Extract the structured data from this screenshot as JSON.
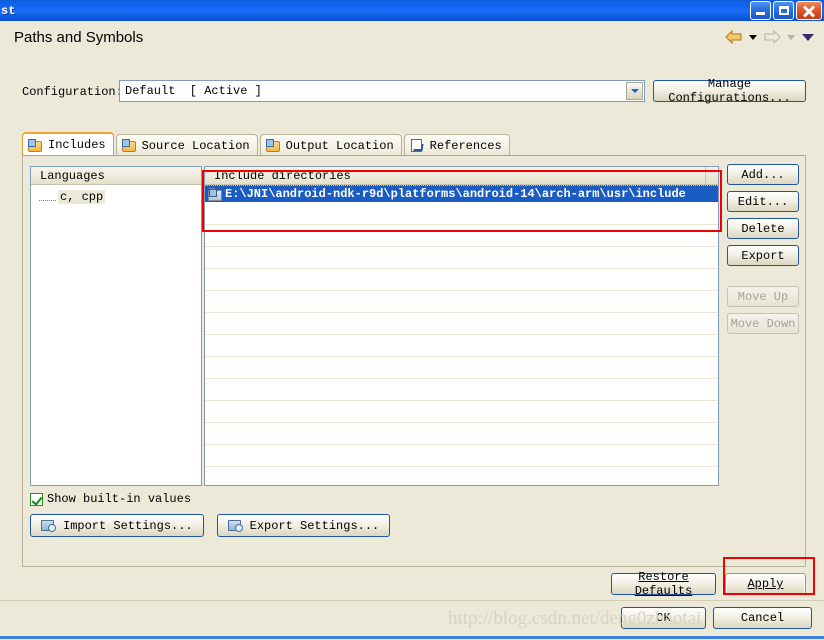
{
  "window": {
    "title": "st",
    "controls": {
      "minimize": "minimize",
      "maximize": "maximize",
      "close": "close"
    }
  },
  "header": {
    "title": "Paths and Symbols",
    "nav_back": "back-arrow",
    "nav_forward": "forward-arrow",
    "nav_menu": "view-menu"
  },
  "configuration": {
    "label": "Configuration:",
    "value": "Default  [ Active ]",
    "manage_button": "Manage Configurations..."
  },
  "tabs": [
    {
      "label": "Includes",
      "icon": "includes-folder-icon",
      "active": true
    },
    {
      "label": "Source Location",
      "icon": "source-location-folder-icon",
      "active": false
    },
    {
      "label": "Output Location",
      "icon": "output-location-folder-icon",
      "active": false
    },
    {
      "label": "References",
      "icon": "references-page-icon",
      "active": false
    }
  ],
  "languages": {
    "header": "Languages",
    "items": [
      "c, cpp"
    ]
  },
  "includes": {
    "header": "Include directories",
    "rows": [
      "E:\\JNI\\android-ndk-r9d\\platforms\\android-14\\arch-arm\\usr\\include"
    ]
  },
  "side_buttons": [
    {
      "label": "Add...",
      "enabled": true
    },
    {
      "label": "Edit...",
      "enabled": true
    },
    {
      "label": "Delete",
      "enabled": true
    },
    {
      "label": "Export",
      "enabled": true
    },
    {
      "label": "Move Up",
      "enabled": false
    },
    {
      "label": "Move Down",
      "enabled": false
    }
  ],
  "options": {
    "show_builtin_label": "Show built-in values",
    "show_builtin_checked": true,
    "import_settings": "Import Settings...",
    "export_settings": "Export Settings..."
  },
  "actions": {
    "restore_defaults": "Restore Defaults",
    "apply": "Apply",
    "ok": "OK",
    "cancel": "Cancel"
  },
  "watermark": "http://blog.csdn.net/deng0zhaotai",
  "colors": {
    "titlebar_blue": "#0f63f0",
    "dialog_bg": "#ece9d8",
    "selection_blue": "#1b5bc4",
    "annotation_red": "#f00000",
    "apply_focus_orange": "#e08a10",
    "active_tab_orange": "#e49b2a"
  }
}
